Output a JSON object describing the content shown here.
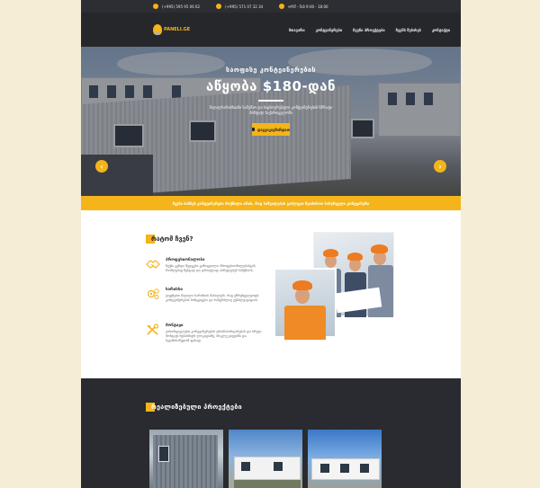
{
  "topbar": {
    "phone1": "(+995) 595 95 06 62",
    "phone2": "(+995) 571 07 32 34",
    "hours": "ორშ - შაბ 9:00 - 18:00"
  },
  "header": {
    "logo_text": "PANELI.GE",
    "nav": [
      "მთავარი",
      "კონტეინერები",
      "ჩვენი პროექტები",
      "ჩვენს შესახებ",
      "კონტაქტი"
    ]
  },
  "hero": {
    "subtitle": "საოფისე კონტეინერების",
    "title": "აწყობა $180-დან",
    "description": "მაღალხარისხიანი სამუშაო და საცხოვრებელი კონტეინერების სწრაფი მონტაჟი საქართველოში",
    "button_label": "დაგვიკავშირდით",
    "prev_arrow": "‹",
    "next_arrow": "›"
  },
  "strip": {
    "text": "ჩვენი ბიზნეს კონტეინერები მოქნილი არის, რაც საშუალებას გაძლევთ შეიძინოთ სასურველი კონტეინერი"
  },
  "why_us": {
    "title": "რატომ ჩვენ?",
    "features": [
      {
        "title": "პროფესიონალობა",
        "icon": "handshake-icon",
        "desc": "ჩვენი გუნდი შედგება გამოცდილი პროფესიონალებისგან, რომლებიც ზუსტად და დროულად ასრულებენ სამუშაოს."
      },
      {
        "title": "ხარისხი",
        "icon": "gears-icon",
        "desc": "ვიყენებთ მაღალი ხარისხის მასალებს, რაც უზრუნველყოფს კონტეინერების სიმტკიცესა და ხანგრძლივ ექსპლუატაციას."
      },
      {
        "title": "მონტაჟი",
        "icon": "tools-icon",
        "desc": "ვახორციელებთ კონტეინერების ტრანსპორტირებას და სრულ მონტაჟს ნებისმიერ ლოკაციაზე, მოკლე ვადებში და ხელმისაწვდომ ფასად."
      }
    ]
  },
  "projects": {
    "title": "რეალიზებული პროექტები"
  },
  "colors": {
    "accent": "#f4b41a",
    "dark": "#2a2b30",
    "page_bg": "#f6edd6"
  }
}
